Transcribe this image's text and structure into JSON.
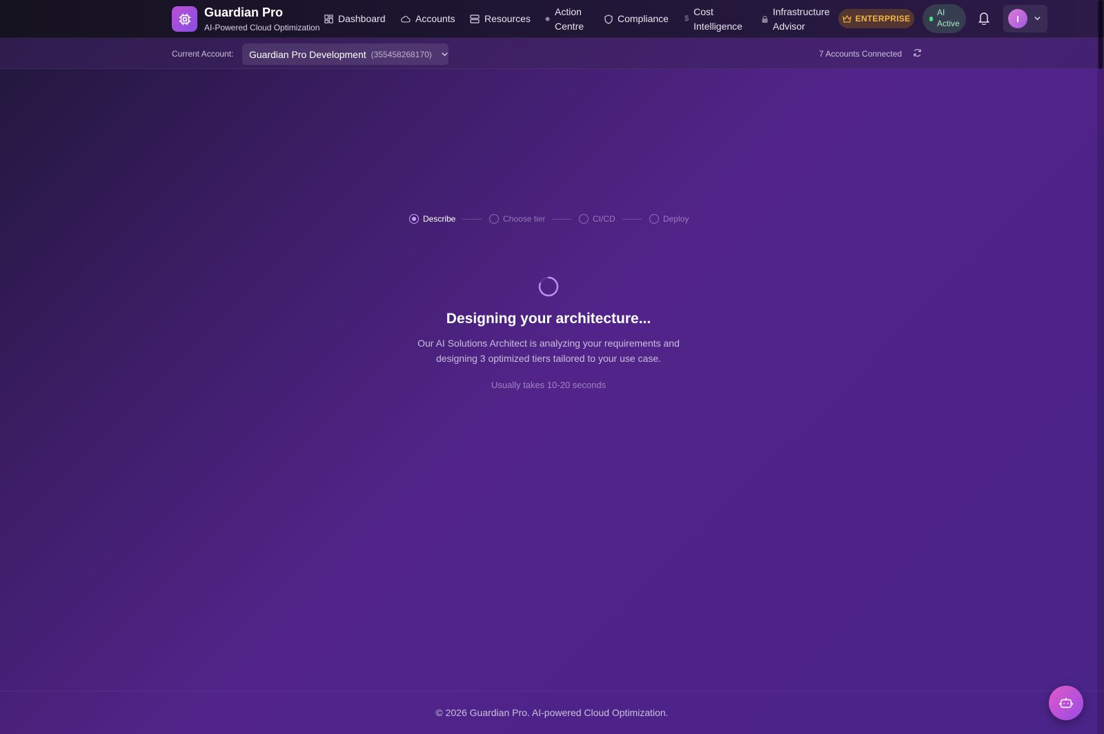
{
  "brand": {
    "title": "Guardian Pro",
    "subtitle": "AI-Powered Cloud Optimization"
  },
  "nav": {
    "items": [
      {
        "label": "Dashboard",
        "icon": "dashboard-icon"
      },
      {
        "label": "Accounts",
        "icon": "cloud-icon"
      },
      {
        "label": "Resources",
        "icon": "server-icon"
      },
      {
        "label": "Action Centre",
        "icon": "dot-icon"
      },
      {
        "label": "Compliance",
        "icon": "shield-icon"
      },
      {
        "label": "Cost Intelligence",
        "icon": "dollar-icon"
      },
      {
        "label": "Infrastructure Advisor",
        "icon": "lock-icon"
      }
    ],
    "enterprise_badge": "ENTERPRISE",
    "ai_status": "AI Active",
    "user_initial": "I"
  },
  "account_bar": {
    "label": "Current Account:",
    "account_name": "Guardian Pro Development",
    "account_id": "(355458268170)",
    "connected": "7 Accounts Connected"
  },
  "stepper": {
    "steps": [
      {
        "label": "Describe",
        "active": true
      },
      {
        "label": "Choose tier",
        "active": false
      },
      {
        "label": "CI/CD",
        "active": false
      },
      {
        "label": "Deploy",
        "active": false
      }
    ]
  },
  "loading": {
    "heading": "Designing your architecture...",
    "description": "Our AI Solutions Architect is analyzing your requirements and designing 3 optimized tiers tailored to your use case.",
    "hint": "Usually takes 10-20 seconds"
  },
  "footer": {
    "text": "© 2026 Guardian Pro. AI-powered Cloud Optimization."
  },
  "colors": {
    "accent": "#b84fd9",
    "enterprise": "#f3b745",
    "ai_active": "#4ade80"
  }
}
